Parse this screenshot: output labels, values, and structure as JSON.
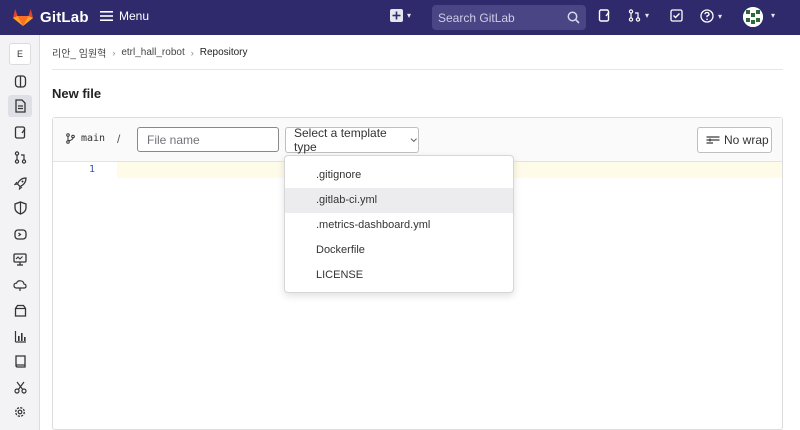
{
  "brand": {
    "name": "GitLab",
    "accent": "#e24329",
    "topbar_color": "#2f2a6b"
  },
  "topbar": {
    "menu_label": "Menu",
    "search_placeholder": "Search GitLab"
  },
  "sidebar": {
    "project_initial": "E",
    "items": [
      {
        "icon": "project-overview-icon"
      },
      {
        "icon": "repository-icon",
        "active": true
      },
      {
        "icon": "issues-icon"
      },
      {
        "icon": "merge-requests-icon"
      },
      {
        "icon": "cicd-rocket-icon"
      },
      {
        "icon": "security-shield-icon"
      },
      {
        "icon": "deployments-icon"
      },
      {
        "icon": "monitor-icon"
      },
      {
        "icon": "infrastructure-icon"
      },
      {
        "icon": "packages-icon"
      },
      {
        "icon": "analytics-icon"
      },
      {
        "icon": "wiki-icon"
      },
      {
        "icon": "snippets-icon"
      },
      {
        "icon": "settings-icon"
      }
    ]
  },
  "breadcrumb": {
    "items": [
      "리안_ 임원혁",
      "etrl_hall_robot",
      "Repository"
    ]
  },
  "page": {
    "title": "New file"
  },
  "editor": {
    "branch": "main",
    "slash": "/",
    "filename_placeholder": "File name",
    "template_button": "Select a template type",
    "nowrap_button": "No wrap",
    "line_number": "1"
  },
  "template_dropdown": {
    "options": [
      ".gitignore",
      ".gitlab-ci.yml",
      ".metrics-dashboard.yml",
      "Dockerfile",
      "LICENSE"
    ],
    "hovered": ".gitlab-ci.yml"
  }
}
